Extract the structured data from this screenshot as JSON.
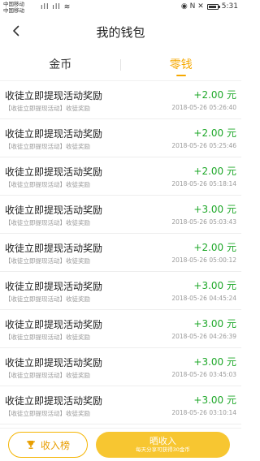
{
  "status_bar": {
    "carrier_1": "中国移动",
    "carrier_2": "中国移动",
    "signal_icons": "ıll ıll ≋",
    "right_icons": "◉ N ✕",
    "time": "5:31"
  },
  "nav": {
    "title": "我的钱包"
  },
  "tabs": [
    {
      "label": "金币",
      "active": false
    },
    {
      "label": "零钱",
      "active": true
    }
  ],
  "records": [
    {
      "title": "收徒立即提现活动奖励",
      "subtitle": "【收徒立即提现活动】收徒奖励",
      "amount": "+2.00 元",
      "time": "2018-05-26 05:26:40"
    },
    {
      "title": "收徒立即提现活动奖励",
      "subtitle": "【收徒立即提现活动】收徒奖励",
      "amount": "+2.00 元",
      "time": "2018-05-26 05:25:46"
    },
    {
      "title": "收徒立即提现活动奖励",
      "subtitle": "【收徒立即提现活动】收徒奖励",
      "amount": "+2.00 元",
      "time": "2018-05-26 05:18:14"
    },
    {
      "title": "收徒立即提现活动奖励",
      "subtitle": "【收徒立即提现活动】收徒奖励",
      "amount": "+3.00 元",
      "time": "2018-05-26 05:03:43"
    },
    {
      "title": "收徒立即提现活动奖励",
      "subtitle": "【收徒立即提现活动】收徒奖励",
      "amount": "+2.00 元",
      "time": "2018-05-26 05:00:12"
    },
    {
      "title": "收徒立即提现活动奖励",
      "subtitle": "【收徒立即提现活动】收徒奖励",
      "amount": "+3.00 元",
      "time": "2018-05-26 04:45:24"
    },
    {
      "title": "收徒立即提现活动奖励",
      "subtitle": "【收徒立即提现活动】收徒奖励",
      "amount": "+3.00 元",
      "time": "2018-05-26 04:26:39"
    },
    {
      "title": "收徒立即提现活动奖励",
      "subtitle": "【收徒立即提现活动】收徒奖励",
      "amount": "+3.00 元",
      "time": "2018-05-26 03:45:03"
    },
    {
      "title": "收徒立即提现活动奖励",
      "subtitle": "【收徒立即提现活动】收徒奖励",
      "amount": "+3.00 元",
      "time": "2018-05-26 03:10:14"
    }
  ],
  "bottom": {
    "rank_label": "收入榜",
    "share_label": "晒收入",
    "share_sub": "每天分享可获得30金币"
  },
  "colors": {
    "accent": "#f6a800",
    "amount_green": "#1fa82a",
    "share_button": "#f7c631"
  }
}
